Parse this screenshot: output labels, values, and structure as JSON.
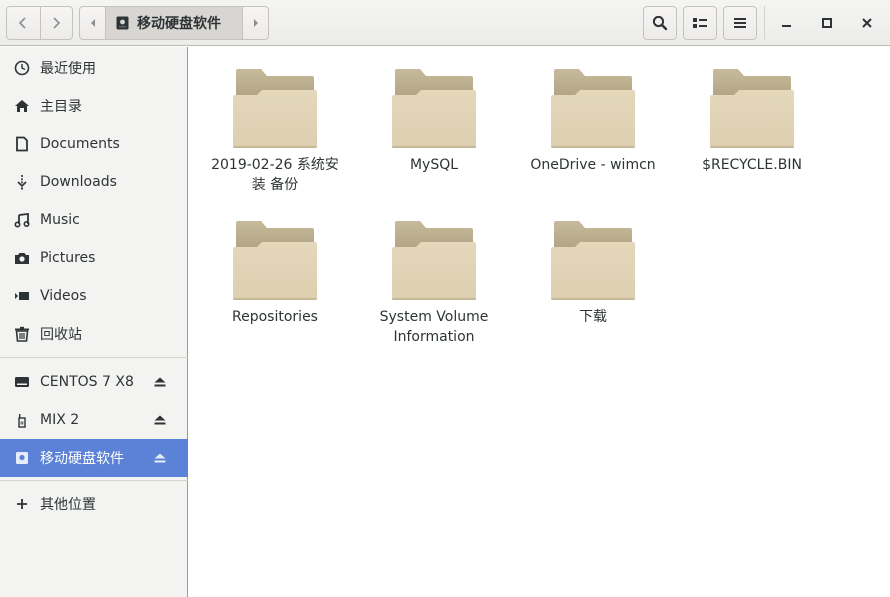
{
  "header": {
    "back_icon": "chevron-left-icon",
    "forward_icon": "chevron-right-icon",
    "path_left_icon": "triangle-left-icon",
    "path_right_icon": "triangle-right-icon",
    "current_location": "移动硬盘软件",
    "current_location_icon": "drive-removable-icon",
    "search_icon": "search-icon",
    "view_toggle_icon": "list-view-icon",
    "menu_icon": "hamburger-menu-icon",
    "minimize_icon": "minimize-icon",
    "maximize_icon": "maximize-icon",
    "close_icon": "close-icon"
  },
  "sidebar": {
    "places": [
      {
        "label": "最近使用",
        "icon": "clock-icon"
      },
      {
        "label": "主目录",
        "icon": "home-icon"
      },
      {
        "label": "Documents",
        "icon": "document-icon"
      },
      {
        "label": "Downloads",
        "icon": "download-icon"
      },
      {
        "label": "Music",
        "icon": "music-icon"
      },
      {
        "label": "Pictures",
        "icon": "camera-icon"
      },
      {
        "label": "Videos",
        "icon": "video-icon"
      },
      {
        "label": "回收站",
        "icon": "trash-icon"
      }
    ],
    "devices": [
      {
        "label": "CENTOS 7 X8",
        "icon": "drive-icon",
        "eject": true,
        "selected": false
      },
      {
        "label": "MIX 2",
        "icon": "phone-icon",
        "eject": true,
        "selected": false
      },
      {
        "label": "移动硬盘软件",
        "icon": "drive-removable-icon",
        "eject": true,
        "selected": true
      }
    ],
    "other": {
      "label": "其他位置",
      "icon": "plus-icon"
    }
  },
  "content": {
    "items": [
      {
        "name": "2019-02-26  系统安装 备份",
        "type": "folder"
      },
      {
        "name": "MySQL",
        "type": "folder"
      },
      {
        "name": "OneDrive - wimcn",
        "type": "folder"
      },
      {
        "name": "$RECYCLE.BIN",
        "type": "folder"
      },
      {
        "name": "Repositories",
        "type": "folder"
      },
      {
        "name": "System Volume Information",
        "type": "folder"
      },
      {
        "name": "下载",
        "type": "folder"
      }
    ]
  },
  "colors": {
    "selection": "#5b82d6",
    "folder_back": "#bfb595",
    "folder_front": "#e2d5b8",
    "sidebar_bg": "#f3f3f2"
  }
}
